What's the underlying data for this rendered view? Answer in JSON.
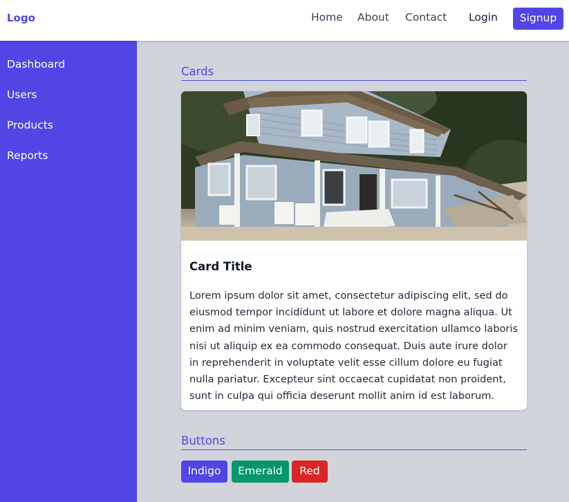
{
  "header": {
    "logo": "Logo",
    "nav": [
      "Home",
      "About",
      "Contact"
    ],
    "login": "Login",
    "signup": "Signup"
  },
  "sidebar": {
    "items": [
      "Dashboard",
      "Users",
      "Products",
      "Reports"
    ]
  },
  "cards_section": {
    "title": "Cards",
    "card": {
      "title": "Card Title",
      "body": "Lorem ipsum dolor sit amet, consectetur adipiscing elit, sed do eiusmod tempor incididunt ut labore et dolore magna aliqua. Ut enim ad minim veniam, quis nostrud exercitation ullamco laboris nisi ut aliquip ex ea commodo consequat. Duis aute irure dolor in reprehenderit in voluptate velit esse cillum dolore eu fugiat nulla pariatur. Excepteur sint occaecat cupidatat non proident, sunt in culpa qui officia deserunt mollit anim id est laborum."
    }
  },
  "buttons_section": {
    "title": "Buttons",
    "buttons": [
      "Indigo",
      "Emerald",
      "Red"
    ]
  },
  "colors": {
    "accent": "#4f46e5",
    "emerald": "#059669",
    "red": "#dc2626",
    "background": "#d1d5db"
  }
}
